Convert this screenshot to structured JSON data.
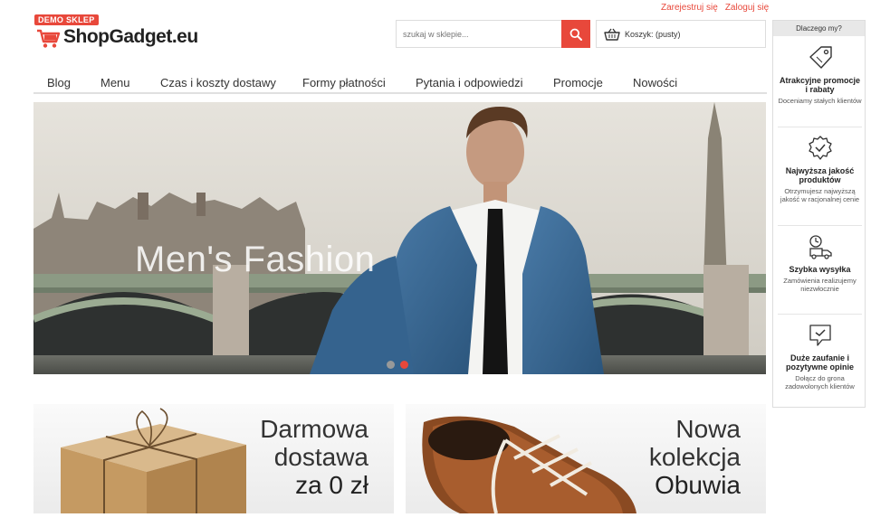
{
  "header": {
    "register_label": "Zarejestruj się",
    "login_label": "Zaloguj się",
    "logo_badge": "DEMO SKLEP",
    "logo_text": "ShopGadget.eu",
    "search_placeholder": "szukaj w sklepie...",
    "cart_label": "Koszyk: (pusty)"
  },
  "nav": {
    "items": [
      "Blog",
      "Menu",
      "Czas i koszty dostawy",
      "Formy płatności",
      "Pytania i odpowiedzi",
      "Promocje",
      "Nowości"
    ]
  },
  "hero": {
    "caption": "Men's Fashion",
    "slide_count": 2,
    "active_slide": 2
  },
  "promos": [
    {
      "lines": [
        "Darmowa",
        "dostawa",
        "za 0 zł"
      ]
    },
    {
      "lines": [
        "Nowa",
        "kolekcja",
        "Obuwia"
      ]
    }
  ],
  "sidebar": {
    "heading": "Dlaczego my?",
    "features": [
      {
        "icon": "price-tag-icon",
        "title": "Atrakcyjne promocje i rabaty",
        "desc": "Doceniamy stałych klientów"
      },
      {
        "icon": "quality-badge-icon",
        "title": "Najwyższa jakość produktów",
        "desc": "Otrzymujesz najwyższą jakość w racjonalnej cenie"
      },
      {
        "icon": "fast-delivery-icon",
        "title": "Szybka wysyłka",
        "desc": "Zamówienia realizujemy niezwłocznie"
      },
      {
        "icon": "trust-chat-icon",
        "title": "Duże zaufanie i pozytywne opinie",
        "desc": "Dołącz do grona zadowolonych klientów"
      }
    ]
  },
  "colors": {
    "accent": "#e8483b",
    "text": "#333333",
    "border": "#dddddd"
  }
}
